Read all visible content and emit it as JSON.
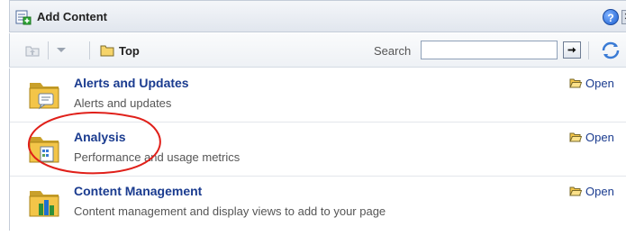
{
  "window": {
    "title": "Add Content",
    "help_glyph": "?",
    "close_glyph": "✕"
  },
  "toolbar": {
    "folder_label": "Top",
    "search_label": "Search",
    "search_value": "",
    "search_placeholder": ""
  },
  "items": [
    {
      "title": "Alerts and Updates",
      "description": "Alerts and updates",
      "open_label": "Open",
      "icon": "alerts-folder-icon"
    },
    {
      "title": "Analysis",
      "description": "Performance and usage metrics",
      "open_label": "Open",
      "icon": "analysis-folder-icon"
    },
    {
      "title": "Content Management",
      "description": "Content management and display views to add to your page",
      "open_label": "Open",
      "icon": "content-management-folder-icon"
    }
  ],
  "colors": {
    "link": "#1a3b8f",
    "folder": "#f3c548",
    "highlight": "#e0201a"
  }
}
